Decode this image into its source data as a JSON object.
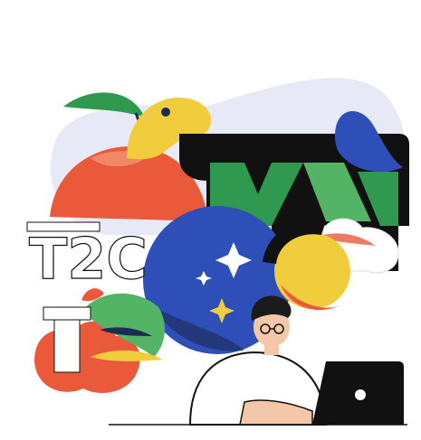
{
  "illustration": {
    "logo_text": "T2C",
    "colors": {
      "background": "#ffffff",
      "lavender_blob": "#e8e9f7",
      "orange": "#ea5a3a",
      "coral_light": "#f39a7e",
      "green": "#2f9a4f",
      "green_light": "#53b466",
      "yellow": "#f1cd3e",
      "blue": "#2f4fb8",
      "dark_navy": "#1d2a52",
      "black": "#111111",
      "white": "#ffffff",
      "skin": "#f4c7a8",
      "hair": "#1b1b1b"
    },
    "icons": [
      "sparkle-icon",
      "laptop-icon",
      "camera-logo-icon"
    ]
  }
}
